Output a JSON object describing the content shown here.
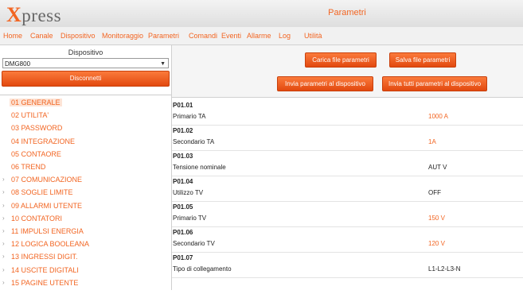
{
  "app": {
    "logo_x": "X",
    "logo_rest": "press",
    "window_title": "Parametri"
  },
  "menu": [
    "Home",
    "Canale",
    "Dispositivo",
    "Monitoraggio",
    "Parametri",
    "Comandi",
    "Eventi",
    "Allarme",
    "Log",
    "Utilità"
  ],
  "left": {
    "device_label": "Dispositivo",
    "device_value": "DMG800",
    "disconnect_label": "Disconnetti"
  },
  "toolbar": {
    "load_label": "Carica file parametri",
    "save_label": "Salva file parametri",
    "send_label": "Invia parametri al dispositivo",
    "send_all_label": "Invia tutti parametri al dispositivo"
  },
  "tree": [
    {
      "label": "01 GENERALE",
      "expandable": false,
      "selected": true
    },
    {
      "label": "02 UTILITA'",
      "expandable": false
    },
    {
      "label": "03 PASSWORD",
      "expandable": false
    },
    {
      "label": "04 INTEGRAZIONE",
      "expandable": false
    },
    {
      "label": "05 CONTAORE",
      "expandable": false
    },
    {
      "label": "06 TREND",
      "expandable": false
    },
    {
      "label": "07 COMUNICAZIONE",
      "expandable": true
    },
    {
      "label": "08 SOGLIE LIMITE",
      "expandable": true
    },
    {
      "label": "09 ALLARMI UTENTE",
      "expandable": true
    },
    {
      "label": "10 CONTATORI",
      "expandable": true
    },
    {
      "label": "11 IMPULSI ENERGIA",
      "expandable": true
    },
    {
      "label": "12 LOGICA BOOLEANA",
      "expandable": true
    },
    {
      "label": "13 INGRESSI DIGIT.",
      "expandable": true
    },
    {
      "label": "14 USCITE DIGITALI",
      "expandable": true
    },
    {
      "label": "15 PAGINE UTENTE",
      "expandable": true
    }
  ],
  "params": [
    {
      "code": "P01.01",
      "name": "Primario TA",
      "value": "1000  A",
      "editable": true
    },
    {
      "code": "P01.02",
      "name": "Secondario TA",
      "value": "1A",
      "editable": true
    },
    {
      "code": "P01.03",
      "name": "Tensione nominale",
      "value": "AUT  V",
      "editable": false
    },
    {
      "code": "P01.04",
      "name": "Utilizzo TV",
      "value": "OFF",
      "editable": false
    },
    {
      "code": "P01.05",
      "name": "Primario TV",
      "value": "150  V",
      "editable": true
    },
    {
      "code": "P01.06",
      "name": "Secondario TV",
      "value": "120  V",
      "editable": true
    },
    {
      "code": "P01.07",
      "name": "Tipo di collegamento",
      "value": "L1-L2-L3-N",
      "editable": false
    }
  ],
  "colors": {
    "accent": "#f26522",
    "selected_bg": "#fde4d6"
  }
}
